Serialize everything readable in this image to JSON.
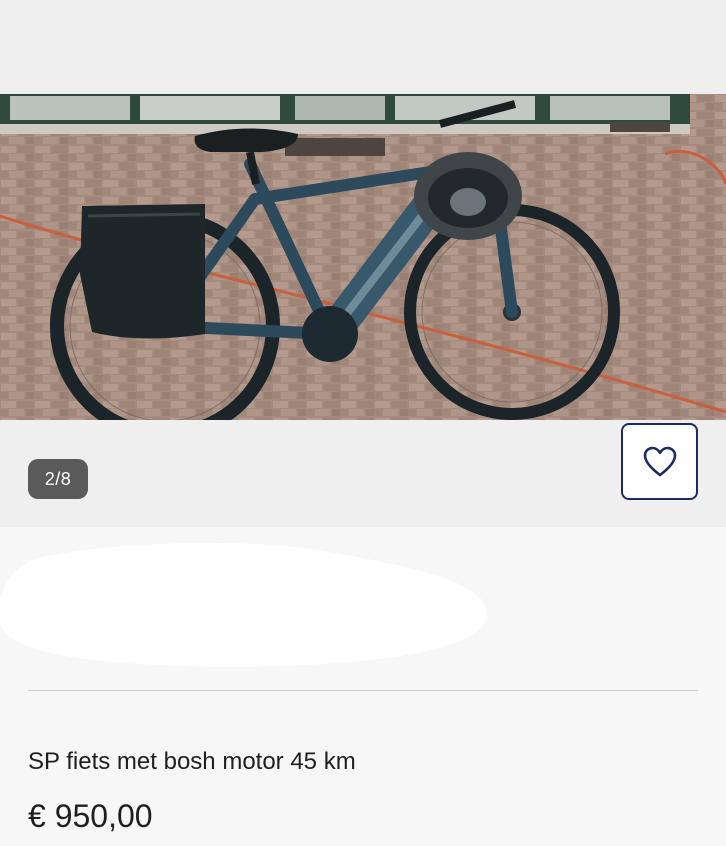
{
  "gallery": {
    "counter": "2/8",
    "favorite_icon": "heart-icon",
    "photo_subject": "bicycle-photo"
  },
  "listing": {
    "title": "SP fiets met bosh motor 45 km",
    "price": "€ 950,00"
  },
  "colors": {
    "accent": "#1c2b66",
    "counter_bg": "#5a5a5a",
    "page_bg": "#f7f7f7"
  }
}
